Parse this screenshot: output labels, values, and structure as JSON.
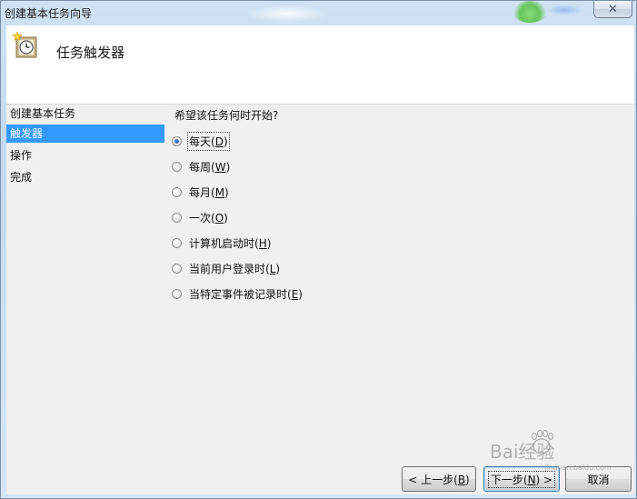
{
  "window": {
    "title": "创建基本任务向导",
    "close_glyph": "✕"
  },
  "header": {
    "title": "任务触发器",
    "icon": "clock-icon"
  },
  "nav": {
    "items": [
      {
        "label": "创建基本任务",
        "selected": false
      },
      {
        "label": "触发器",
        "selected": true
      },
      {
        "label": "操作",
        "selected": false
      },
      {
        "label": "完成",
        "selected": false
      }
    ]
  },
  "main": {
    "question": "希望该任务何时开始?",
    "options": [
      {
        "pre": "每天(",
        "key": "D",
        "post": ")",
        "checked": true
      },
      {
        "pre": "每周(",
        "key": "W",
        "post": ")",
        "checked": false
      },
      {
        "pre": "每月(",
        "key": "M",
        "post": ")",
        "checked": false
      },
      {
        "pre": "一次(",
        "key": "O",
        "post": ")",
        "checked": false
      },
      {
        "pre": "计算机启动时(",
        "key": "H",
        "post": ")",
        "checked": false
      },
      {
        "pre": "当前用户登录时(",
        "key": "L",
        "post": ")",
        "checked": false
      },
      {
        "pre": "当特定事件被记录时(",
        "key": "E",
        "post": ")",
        "checked": false
      }
    ]
  },
  "buttons": {
    "back": {
      "pre": "< 上一步(",
      "key": "B",
      "post": ")"
    },
    "next": {
      "pre": "下一步(",
      "key": "N",
      "post": ") >"
    },
    "cancel": {
      "label": "取消"
    }
  },
  "watermark": {
    "text": "Bai经验",
    "sub": "jingyan.baidu.com"
  },
  "colors": {
    "selection": "#3399ff",
    "panel": "#f0f0f0",
    "header": "#ffffff"
  }
}
